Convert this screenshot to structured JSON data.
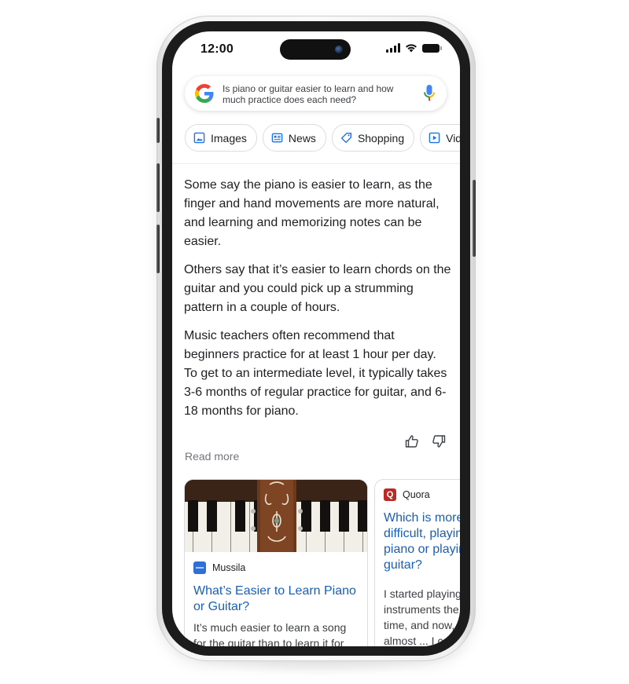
{
  "status_bar": {
    "time": "12:00"
  },
  "search": {
    "query": "Is piano or guitar easier to learn and how much practice does each need?",
    "logo_icon": "google-g-logo",
    "mic_icon": "microphone-icon"
  },
  "chips": [
    {
      "label": "Images",
      "icon": "image-icon"
    },
    {
      "label": "News",
      "icon": "news-icon"
    },
    {
      "label": "Shopping",
      "icon": "tag-icon"
    },
    {
      "label": "Videos",
      "icon": "play-icon"
    }
  ],
  "answer": {
    "paragraphs": [
      "Some say the piano is easier to learn, as the finger and hand movements are more natural, and learning and memorizing notes can be easier.",
      "Others say that it’s easier to learn chords on the guitar and you could pick up a strumming pattern in a couple of hours.",
      "Music teachers often recommend that beginners practice for at least 1 hour per day. To get to an intermediate level, it typically takes 3-6 months of regular practice for guitar, and 6-18 months for piano."
    ],
    "read_more": "Read more",
    "thumbs_up_icon": "thumbs-up-icon",
    "thumbs_down_icon": "thumbs-down-icon"
  },
  "results": [
    {
      "source": "Mussila",
      "favicon_color": "#2f6fd6",
      "title": "What’s Easier to Learn Piano or Guitar?",
      "snippet": "It’s much easier to learn a song for the guitar than to learn it for"
    },
    {
      "source": "Quora",
      "favicon_letter": "Q",
      "favicon_color": "#b92b27",
      "title": "Which is more difficult, playing piano or playing guitar?",
      "snippet": "I started playing both instruments the same time, and now, after almost ... I continue to develop, proficient on"
    }
  ],
  "colors": {
    "link": "#1a5fb4",
    "text": "#202124",
    "muted": "#70757a"
  }
}
